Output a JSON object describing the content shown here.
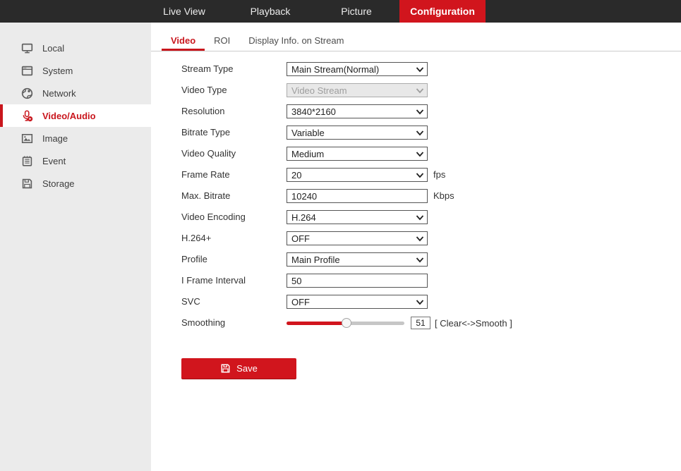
{
  "topnav": {
    "tabs": [
      {
        "label": "Live View",
        "active": false
      },
      {
        "label": "Playback",
        "active": false
      },
      {
        "label": "Picture",
        "active": false
      },
      {
        "label": "Configuration",
        "active": true
      }
    ]
  },
  "sidebar": {
    "items": [
      {
        "label": "Local",
        "icon": "monitor-icon",
        "active": false
      },
      {
        "label": "System",
        "icon": "window-icon",
        "active": false
      },
      {
        "label": "Network",
        "icon": "globe-icon",
        "active": false
      },
      {
        "label": "Video/Audio",
        "icon": "microphone-icon",
        "active": true
      },
      {
        "label": "Image",
        "icon": "image-icon",
        "active": false
      },
      {
        "label": "Event",
        "icon": "event-icon",
        "active": false
      },
      {
        "label": "Storage",
        "icon": "storage-icon",
        "active": false
      }
    ]
  },
  "content": {
    "tabs": [
      {
        "label": "Video",
        "active": true
      },
      {
        "label": "ROI",
        "active": false
      },
      {
        "label": "Display Info. on Stream",
        "active": false
      }
    ],
    "form": {
      "fields": [
        {
          "label": "Stream Type",
          "type": "select",
          "value": "Main Stream(Normal)",
          "disabled": false
        },
        {
          "label": "Video Type",
          "type": "select",
          "value": "Video Stream",
          "disabled": true
        },
        {
          "label": "Resolution",
          "type": "select",
          "value": "3840*2160",
          "disabled": false
        },
        {
          "label": "Bitrate Type",
          "type": "select",
          "value": "Variable",
          "disabled": false
        },
        {
          "label": "Video Quality",
          "type": "select",
          "value": "Medium",
          "disabled": false
        },
        {
          "label": "Frame Rate",
          "type": "select",
          "value": "20",
          "suffix": "fps",
          "disabled": false
        },
        {
          "label": "Max. Bitrate",
          "type": "input",
          "value": "10240",
          "suffix": "Kbps",
          "disabled": false
        },
        {
          "label": "Video Encoding",
          "type": "select",
          "value": "H.264",
          "disabled": false
        },
        {
          "label": "H.264+",
          "type": "select",
          "value": "OFF",
          "disabled": false
        },
        {
          "label": "Profile",
          "type": "select",
          "value": "Main Profile",
          "disabled": false
        },
        {
          "label": "I Frame Interval",
          "type": "input",
          "value": "50",
          "disabled": false
        },
        {
          "label": "SVC",
          "type": "select",
          "value": "OFF",
          "disabled": false
        },
        {
          "label": "Smoothing",
          "type": "slider",
          "value": 51,
          "range_label": "[ Clear<->Smooth ]"
        }
      ],
      "save_label": "Save",
      "save_icon": "save-icon"
    }
  },
  "colors": {
    "accent_red": "#d1151d",
    "active_text_red": "#c9161d",
    "header_bg": "#2a2a2a",
    "sidebar_bg": "#ebebeb",
    "tab_divider": "#cccccc"
  }
}
